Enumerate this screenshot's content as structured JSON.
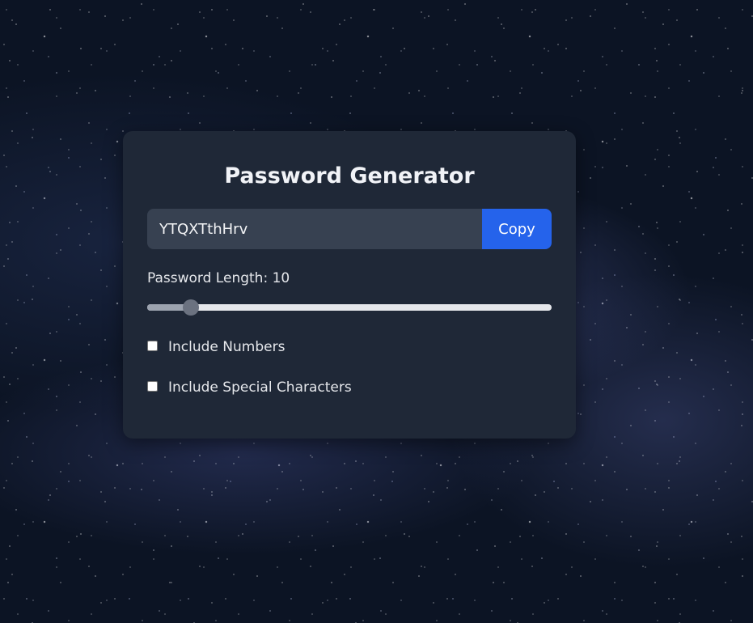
{
  "app": {
    "title": "Password Generator"
  },
  "password": {
    "value": "YTQXTthHrv",
    "copy_label": "Copy"
  },
  "length": {
    "label": "Password Length: 10",
    "value": 10,
    "min": 6,
    "max": 50
  },
  "options": [
    {
      "label": "Include Numbers",
      "checked": false
    },
    {
      "label": "Include Special Characters",
      "checked": false
    }
  ],
  "colors": {
    "card": "#1f2837",
    "input": "#374151",
    "accent": "#2563eb"
  }
}
